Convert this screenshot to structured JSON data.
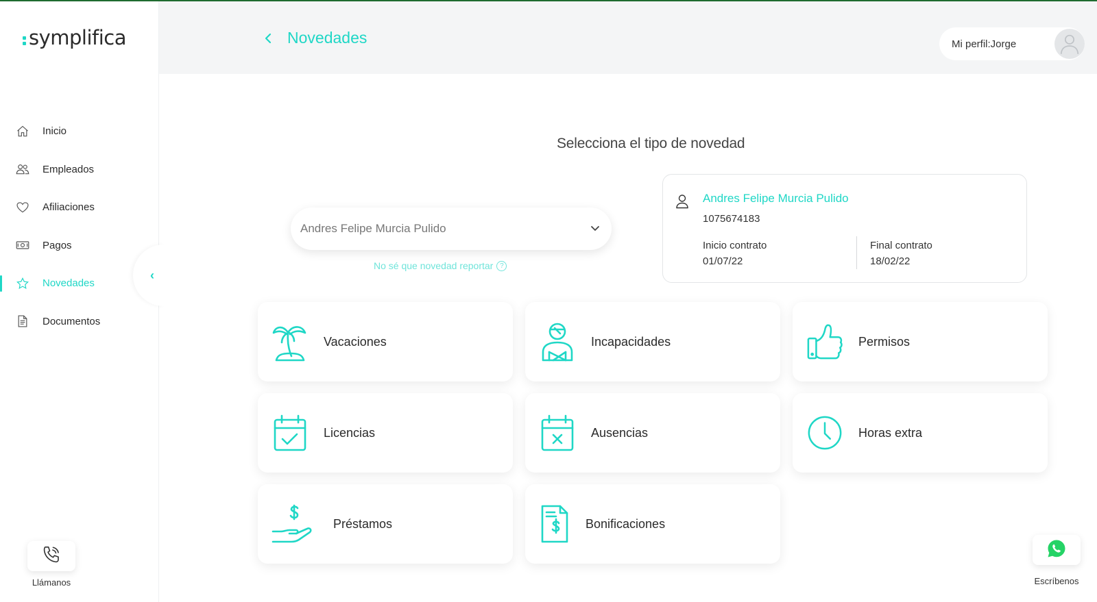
{
  "brand": {
    "logo_text": "symplifica",
    "accent_color": "#1fd7c6"
  },
  "sidebar": {
    "items": [
      {
        "label": "Inicio",
        "icon": "home-icon"
      },
      {
        "label": "Empleados",
        "icon": "users-icon"
      },
      {
        "label": "Afiliaciones",
        "icon": "heart-icon"
      },
      {
        "label": "Pagos",
        "icon": "cash-icon"
      },
      {
        "label": "Novedades",
        "icon": "star-icon",
        "active": true
      },
      {
        "label": "Documentos",
        "icon": "document-icon"
      }
    ],
    "call_label": "Llámanos",
    "write_label": "Escríbenos"
  },
  "header": {
    "title": "Novedades",
    "profile": "Mi perfil:Jorge"
  },
  "main": {
    "subtitle": "Selecciona el tipo de novedad",
    "employee_select": {
      "value": "Andres Felipe Murcia Pulido"
    },
    "help_link": "No sé que novedad reportar",
    "employee_card": {
      "name": "Andres Felipe Murcia Pulido",
      "id": "1075674183",
      "start_label": "Inicio contrato",
      "start_value": "01/07/22",
      "end_label": "Final contrato",
      "end_value": "18/02/22"
    },
    "types": [
      {
        "label": "Vacaciones",
        "icon": "palm-tree-icon"
      },
      {
        "label": "Incapacidades",
        "icon": "injured-person-icon"
      },
      {
        "label": "Permisos",
        "icon": "thumbs-up-icon"
      },
      {
        "label": "Licencias",
        "icon": "calendar-check-icon"
      },
      {
        "label": "Ausencias",
        "icon": "calendar-x-icon"
      },
      {
        "label": "Horas extra",
        "icon": "clock-icon"
      },
      {
        "label": "Préstamos",
        "icon": "loan-hand-icon"
      },
      {
        "label": "Bonificaciones",
        "icon": "bonus-document-icon"
      }
    ]
  }
}
